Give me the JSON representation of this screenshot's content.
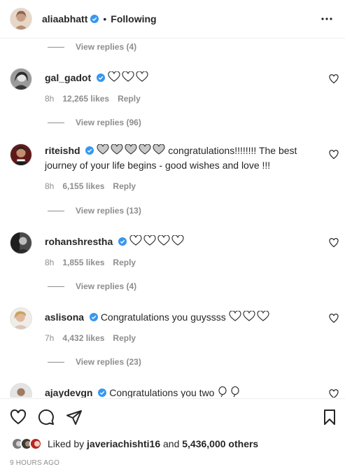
{
  "header": {
    "username": "aliaabhatt",
    "separator": "•",
    "follow_status": "Following"
  },
  "replies": [
    {
      "label": "View replies (4)"
    },
    {
      "label": "View replies (96)"
    },
    {
      "label": "View replies (13)"
    },
    {
      "label": "View replies (4)"
    },
    {
      "label": "View replies (23)"
    }
  ],
  "comments": [
    {
      "username": "gal_gadot",
      "text": "",
      "time": "8h",
      "likes": "12,265 likes",
      "reply": "Reply"
    },
    {
      "username": "riteishd",
      "text": "congratulations!!!!!!!! The best journey of your life begins - good wishes and love !!!",
      "time": "8h",
      "likes": "6,155 likes",
      "reply": "Reply"
    },
    {
      "username": "rohanshrestha",
      "text": "",
      "time": "8h",
      "likes": "1,855 likes",
      "reply": "Reply"
    },
    {
      "username": "aslisona",
      "text": "Congratulations you guyssss",
      "time": "7h",
      "likes": "4,432 likes",
      "reply": "Reply"
    },
    {
      "username": "ajaydevgn",
      "text": "Congratulations you two",
      "time": "",
      "likes": "",
      "reply": ""
    }
  ],
  "liked_by": {
    "prefix": "Liked by",
    "user": "javeriachishti16",
    "conjunction": "and",
    "count": "5,436,000 others"
  },
  "timestamp": "9 HOURS AGO",
  "icons": [
    "more-icon",
    "heart-icon",
    "comment-icon",
    "share-icon",
    "bookmark-icon",
    "verified-badge-icon"
  ],
  "colors": {
    "verified": "#3897f0",
    "muted": "#8e8e8e",
    "text": "#262626"
  }
}
